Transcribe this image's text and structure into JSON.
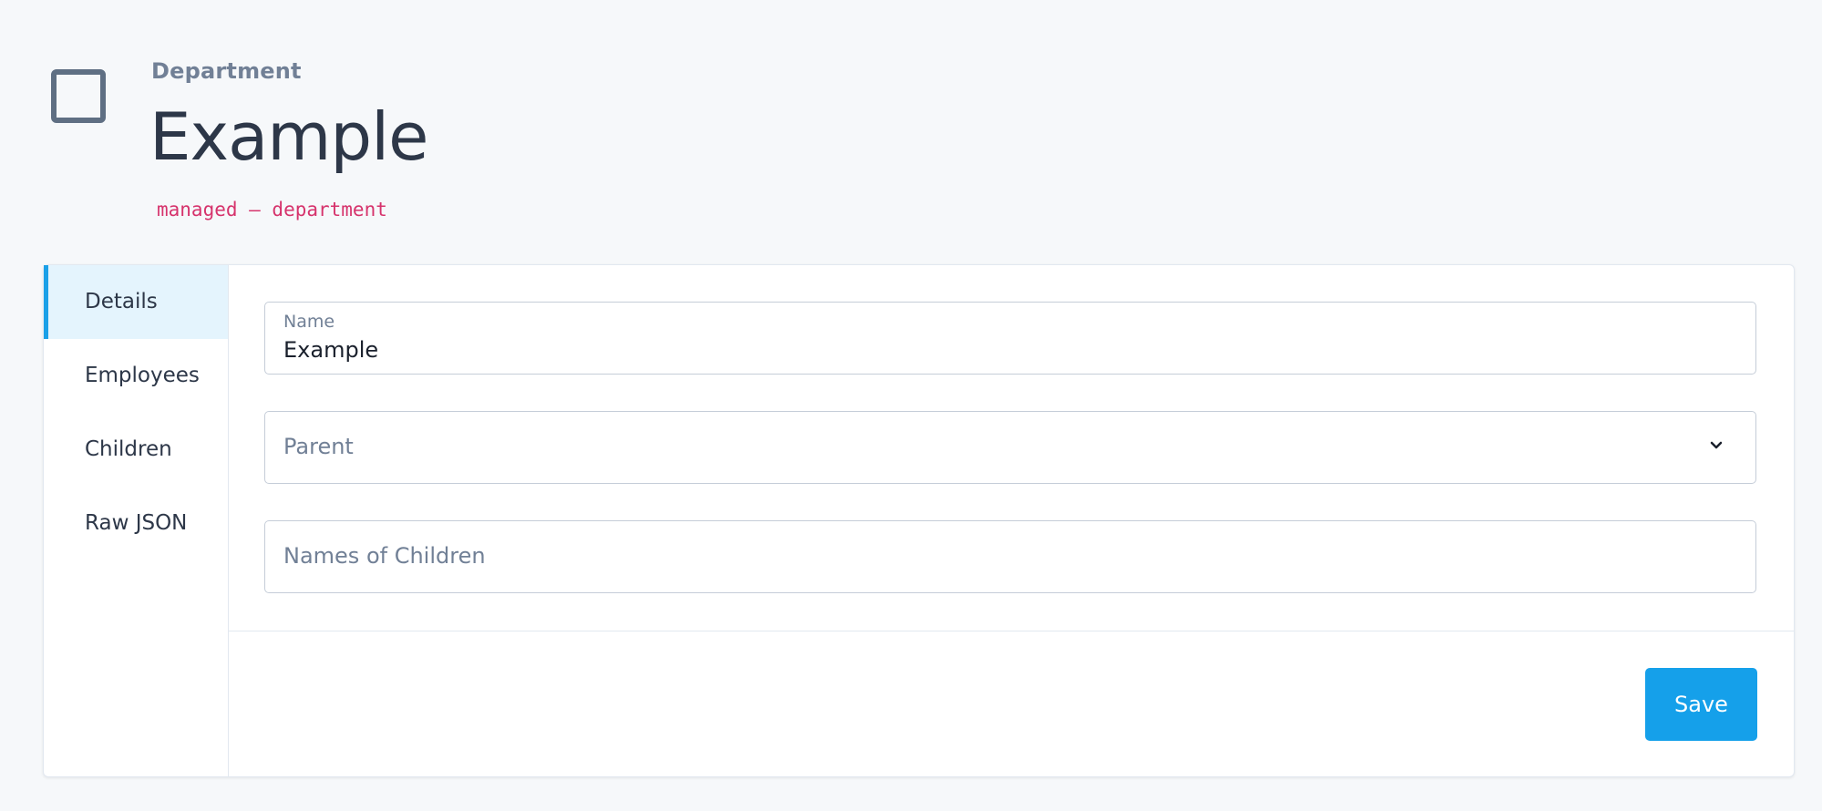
{
  "header": {
    "entity_type": "Department",
    "title": "Example",
    "code": "managed – department",
    "icon": "square-outline-icon"
  },
  "sidebar": {
    "items": [
      {
        "label": "Details",
        "active": true
      },
      {
        "label": "Employees",
        "active": false
      },
      {
        "label": "Children",
        "active": false
      },
      {
        "label": "Raw JSON",
        "active": false
      }
    ]
  },
  "form": {
    "name_label": "Name",
    "name_value": "Example",
    "parent_placeholder": "Parent",
    "children_placeholder": "Names of Children"
  },
  "actions": {
    "save_label": "Save"
  },
  "colors": {
    "accent": "#15a0ea",
    "code": "#d6336c",
    "active_bg": "#e4f4fd"
  }
}
